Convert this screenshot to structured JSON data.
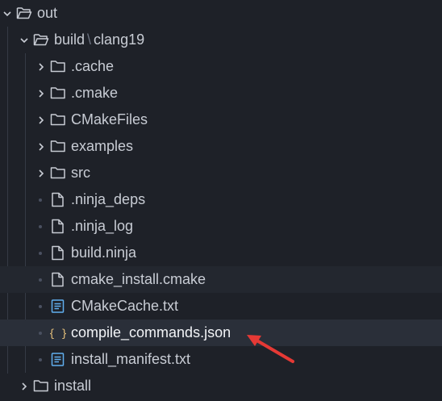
{
  "explorer": {
    "out": {
      "label": "out",
      "expanded": true
    },
    "build": {
      "label_build": "build",
      "separator": "\\",
      "label_sub": "clang19",
      "expanded": true
    },
    "folders": [
      ".cache",
      ".cmake",
      "CMakeFiles",
      "examples",
      "src"
    ],
    "files": [
      {
        "name": ".ninja_deps",
        "icon": "file-icon"
      },
      {
        "name": ".ninja_log",
        "icon": "file-icon"
      },
      {
        "name": "build.ninja",
        "icon": "file-icon"
      },
      {
        "name": "cmake_install.cmake",
        "icon": "file-icon"
      },
      {
        "name": "CMakeCache.txt",
        "icon": "text-file-icon"
      },
      {
        "name": "compile_commands.json",
        "icon": "json-icon",
        "selected": true
      },
      {
        "name": "install_manifest.txt",
        "icon": "text-file-icon"
      }
    ],
    "install": {
      "label": "install",
      "expanded": false
    }
  },
  "colors": {
    "background": "#1e2128",
    "text": "#c8ccd4",
    "selected_text": "#f2f4f7",
    "json_icon": "#e5c07b",
    "text_file_icon": "#61afef",
    "annotation_arrow": "#e53935"
  }
}
